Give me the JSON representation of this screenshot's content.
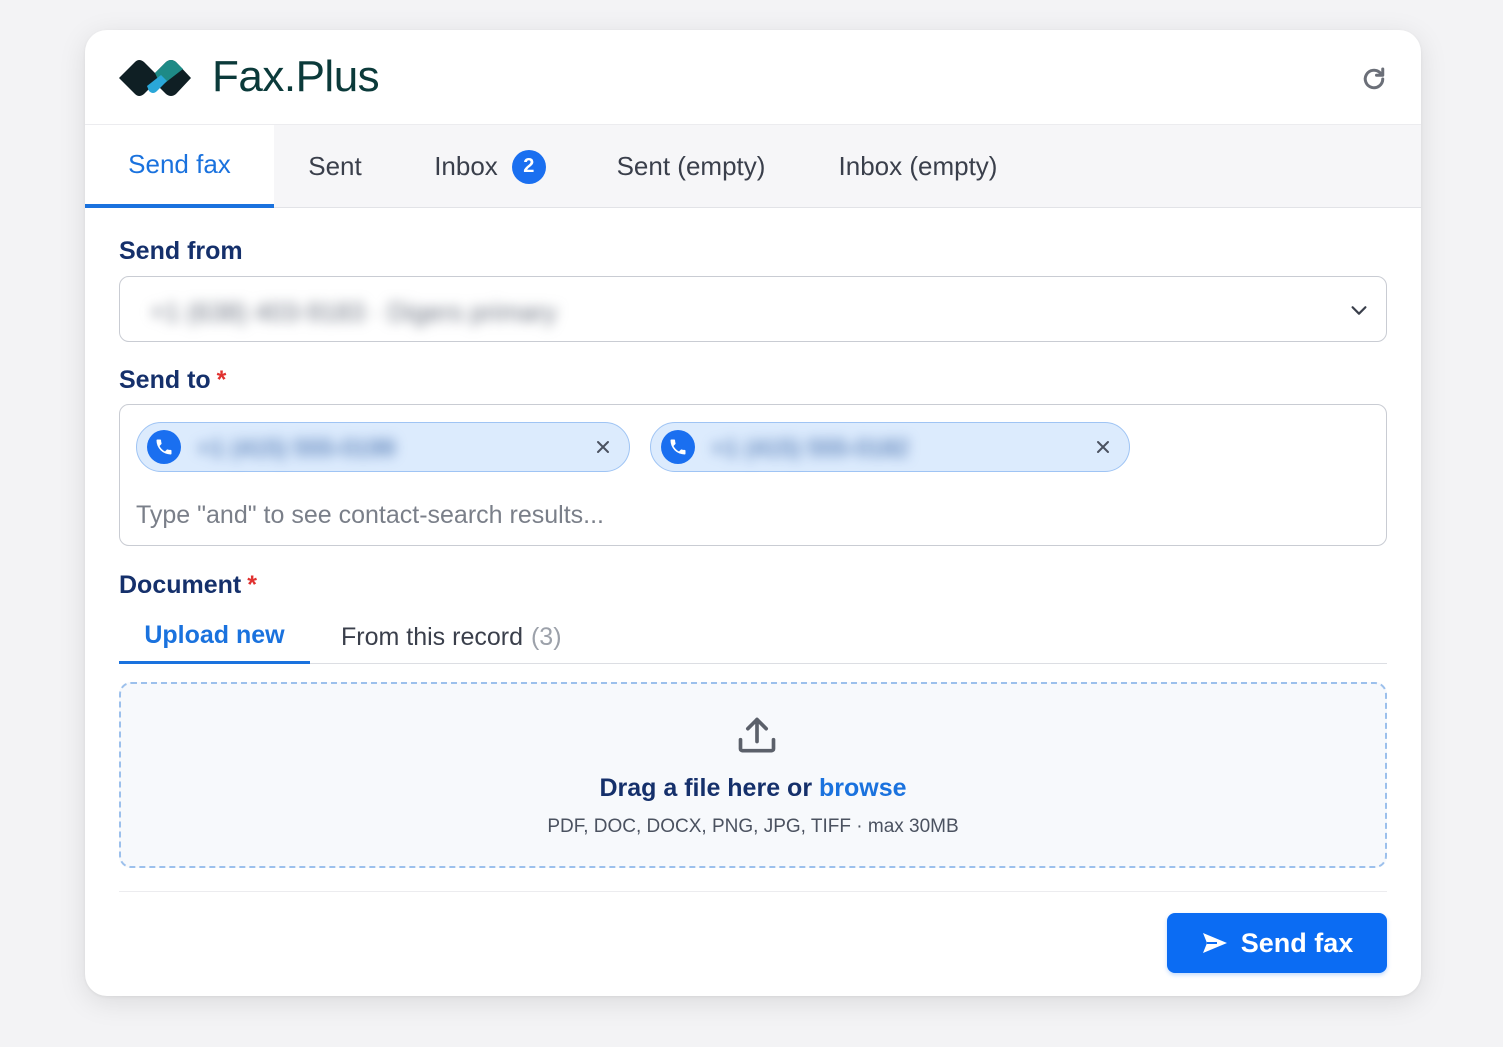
{
  "app": {
    "brand": "Fax.Plus"
  },
  "tabs": [
    {
      "label": "Send fax",
      "active": true
    },
    {
      "label": "Sent"
    },
    {
      "label": "Inbox",
      "badge": "2"
    },
    {
      "label": "Sent (empty)"
    },
    {
      "label": "Inbox (empty)"
    }
  ],
  "form": {
    "send_from": {
      "label": "Send from",
      "value": "+1 (638) 403-9183 · Digers primary"
    },
    "send_to": {
      "label": "Send to",
      "required_mark": "*",
      "recipients": [
        {
          "number": "+1 (415) 555-0199"
        },
        {
          "number": "+1 (415) 555-0182"
        }
      ],
      "placeholder": "Type \"and\" to see contact-search results..."
    },
    "document": {
      "label": "Document",
      "required_mark": "*",
      "tabs": [
        {
          "label": "Upload new",
          "active": true
        },
        {
          "label": "From this record",
          "count": "(3)"
        }
      ],
      "dropzone": {
        "text": "Drag a file here or",
        "browse": "browse",
        "formats": "PDF, DOC, DOCX, PNG, JPG, TIFF · max 30MB"
      }
    },
    "submit_label": "Send fax"
  },
  "icons": {
    "refresh": "refresh-icon",
    "chevron": "chevron-down-icon",
    "phone": "phone-icon",
    "close": "close-icon",
    "upload": "upload-icon",
    "send": "send-icon"
  },
  "colors": {
    "accent": "#1a72de",
    "button": "#0b6cf3",
    "required": "#e0312f",
    "chip_bg": "#dcebfd"
  }
}
